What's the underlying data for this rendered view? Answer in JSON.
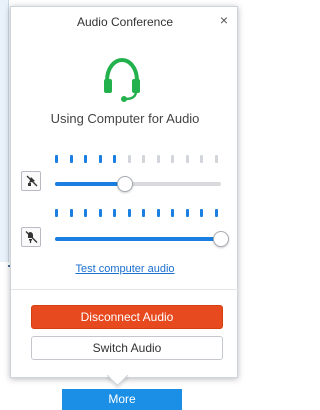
{
  "popup": {
    "title": "Audio Conference",
    "close_glyph": "×",
    "status_text": "Using Computer for Audio",
    "headset_icon": "headset-icon",
    "accent_color": "#23b14d"
  },
  "microphone": {
    "mute_icon": "microphone-muted-icon",
    "input_level_active_segments": 5,
    "input_level_total_segments": 12,
    "volume_percent": 42
  },
  "speaker": {
    "mute_icon": "speaker-muted-icon",
    "output_level_active_segments": 12,
    "output_level_total_segments": 12,
    "volume_percent": 100
  },
  "links": {
    "test_audio": "Test computer audio"
  },
  "buttons": {
    "disconnect": "Disconnect Audio",
    "switch": "Switch Audio",
    "disconnect_color": "#e84a1f"
  },
  "background": {
    "more_button": "More"
  }
}
